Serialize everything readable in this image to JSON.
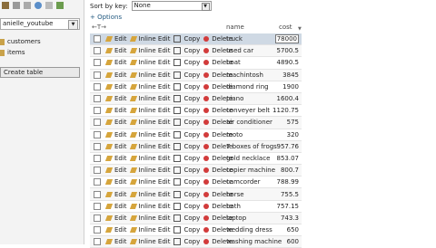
{
  "sidebar": {
    "db_name": "anielle_youtube",
    "tables": [
      "customers",
      "items"
    ],
    "create_label": "Create table"
  },
  "topbar": {
    "sort_label": "Sort by key:",
    "sort_value": "None",
    "options_label": "+ Options"
  },
  "columns": {
    "name": "name",
    "cost": "cost"
  },
  "actions": {
    "edit": "Edit",
    "inline_edit": "Inline Edit",
    "copy": "Copy",
    "delete": "Delete"
  },
  "rows": [
    {
      "name": "truck",
      "cost": "78000"
    },
    {
      "name": "used car",
      "cost": "5700.5"
    },
    {
      "name": "boat",
      "cost": "4890.5"
    },
    {
      "name": "machintosh",
      "cost": "3845"
    },
    {
      "name": "diamond ring",
      "cost": "1900"
    },
    {
      "name": "piano",
      "cost": "1600.4"
    },
    {
      "name": "conveyer belt",
      "cost": "1120.75"
    },
    {
      "name": "air conditioner",
      "cost": "575"
    },
    {
      "name": "moto",
      "cost": "320"
    },
    {
      "name": "7 boxes of frogs",
      "cost": "957.76"
    },
    {
      "name": "gold necklace",
      "cost": "853.07"
    },
    {
      "name": "copier machine",
      "cost": "800.7"
    },
    {
      "name": "camcorder",
      "cost": "788.99"
    },
    {
      "name": "horse",
      "cost": "755.5"
    },
    {
      "name": "bath",
      "cost": "757.15"
    },
    {
      "name": "laptop",
      "cost": "743.3"
    },
    {
      "name": "wedding dress",
      "cost": "650"
    },
    {
      "name": "washing machine",
      "cost": "600"
    }
  ]
}
